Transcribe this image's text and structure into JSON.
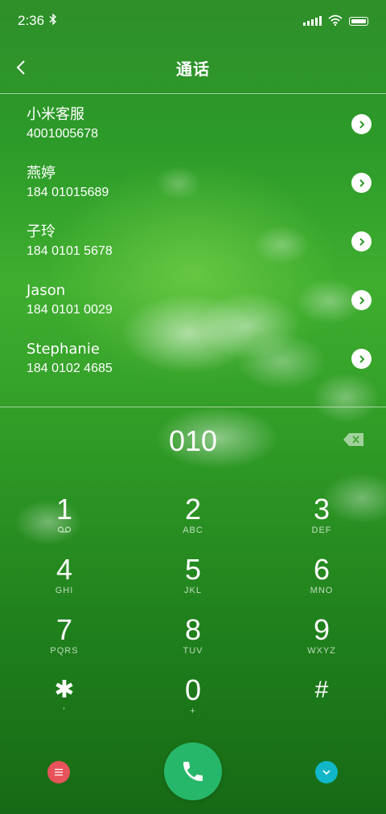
{
  "status_bar": {
    "time": "2:36",
    "icons": [
      "bluetooth-icon",
      "signal-icon",
      "wifi-icon",
      "battery-icon"
    ]
  },
  "header": {
    "title": "通话",
    "back_icon": "chevron-left-icon"
  },
  "contacts": [
    {
      "name": "小米客服",
      "number": "4001005678"
    },
    {
      "name": "燕婷",
      "number": "184 01015689"
    },
    {
      "name": "子玲",
      "number": "184 0101 5678"
    },
    {
      "name": "Jason",
      "number": "184 0101 0029"
    },
    {
      "name": "Stephanie",
      "number": "184 0102 4685"
    }
  ],
  "dialer": {
    "input": "010",
    "backspace_icon": "backspace-icon"
  },
  "keypad": [
    [
      {
        "digit": "1",
        "letters": ""
      },
      {
        "digit": "2",
        "letters": "ABC"
      },
      {
        "digit": "3",
        "letters": "DEF"
      }
    ],
    [
      {
        "digit": "4",
        "letters": "GHI"
      },
      {
        "digit": "5",
        "letters": "JKL"
      },
      {
        "digit": "6",
        "letters": "MNO"
      }
    ],
    [
      {
        "digit": "7",
        "letters": "PQRS"
      },
      {
        "digit": "8",
        "letters": "TUV"
      },
      {
        "digit": "9",
        "letters": "WXYZ"
      }
    ],
    [
      {
        "digit": "✱",
        "letters": "'"
      },
      {
        "digit": "0",
        "letters": "+"
      },
      {
        "digit": "#",
        "letters": ""
      }
    ]
  ],
  "bottom_bar": {
    "menu_icon": "menu-icon",
    "call_icon": "phone-icon",
    "collapse_icon": "chevron-down-icon"
  },
  "colors": {
    "menu_button": "#e8535b",
    "call_button": "#27b76a",
    "collapse_button": "#11b7c8"
  }
}
